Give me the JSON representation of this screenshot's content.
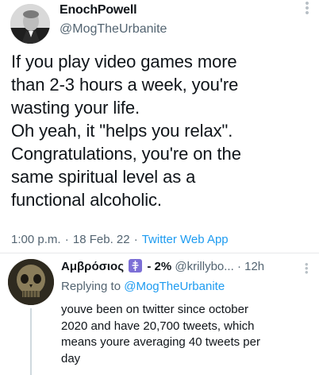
{
  "main_tweet": {
    "display_name": "EnochPowell",
    "handle": "@MogTheUrbanite",
    "text": "If you play video games more\nthan 2-3 hours a week, you're\nwasting your life.\nOh yeah, it \"helps you relax\".\nCongratulations, you're on the\nsame spiritual level as a\nfunctional alcoholic.",
    "time": "1:00 p.m.",
    "date": "18 Feb. 22",
    "source_app": "Twitter Web App",
    "separator": "·"
  },
  "reply": {
    "display_name": "Αμβρόσιος",
    "percent": "- 2%",
    "handle": "@krillybo...",
    "separator": "·",
    "time": "12h",
    "replying_prefix": "Replying to",
    "replying_to": "@MogTheUrbanite",
    "text": "youve been on twitter since october\n2020 and have 20,700 tweets, which\nmeans youre averaging 40 tweets per\nday"
  },
  "icons": {
    "more": "more-vertical-icon",
    "badge": "orthodox-cross-flag-icon"
  },
  "colors": {
    "link": "#1d9bf0",
    "secondary_text": "#536471",
    "badge": "#7c6fd6"
  }
}
